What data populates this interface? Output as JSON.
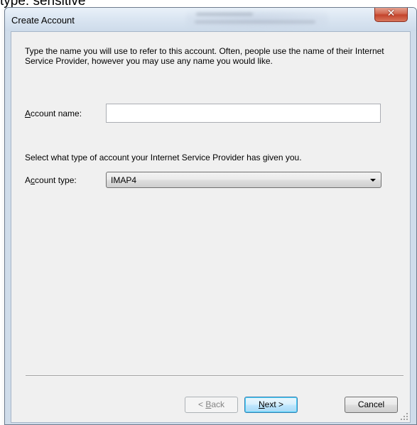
{
  "background_caption": "type: sensitive",
  "window": {
    "title": "Create Account",
    "close_glyph": "✕",
    "obscured_title_text": "Incident ID: 9 ..."
  },
  "form": {
    "intro_text": "Type the name you will use to refer to this account.  Often, people use the name of their Internet Service Provider, however you may use any name you would like.",
    "account_name": {
      "label_mnemonic": "A",
      "label_rest": "ccount name:",
      "value": ""
    },
    "type_instruction": "Select what type of account your Internet Service Provider has given you.",
    "account_type": {
      "label_before": "A",
      "label_mnemonic": "c",
      "label_rest": "count type:",
      "selected": "IMAP4"
    }
  },
  "buttons": {
    "back": {
      "prefix": "< ",
      "mnemonic": "B",
      "rest": "ack"
    },
    "next": {
      "mnemonic": "N",
      "rest": "ext >"
    },
    "cancel": "Cancel"
  },
  "icons": {
    "close": "close-icon",
    "dropdown": "chevron-down-icon",
    "resize": "resize-grip-icon"
  },
  "colors": {
    "title_bar": "#dbe6f2",
    "close_button": "#c4442c",
    "client_background": "#f0f0f0",
    "default_button_border": "#3c7fb1"
  }
}
